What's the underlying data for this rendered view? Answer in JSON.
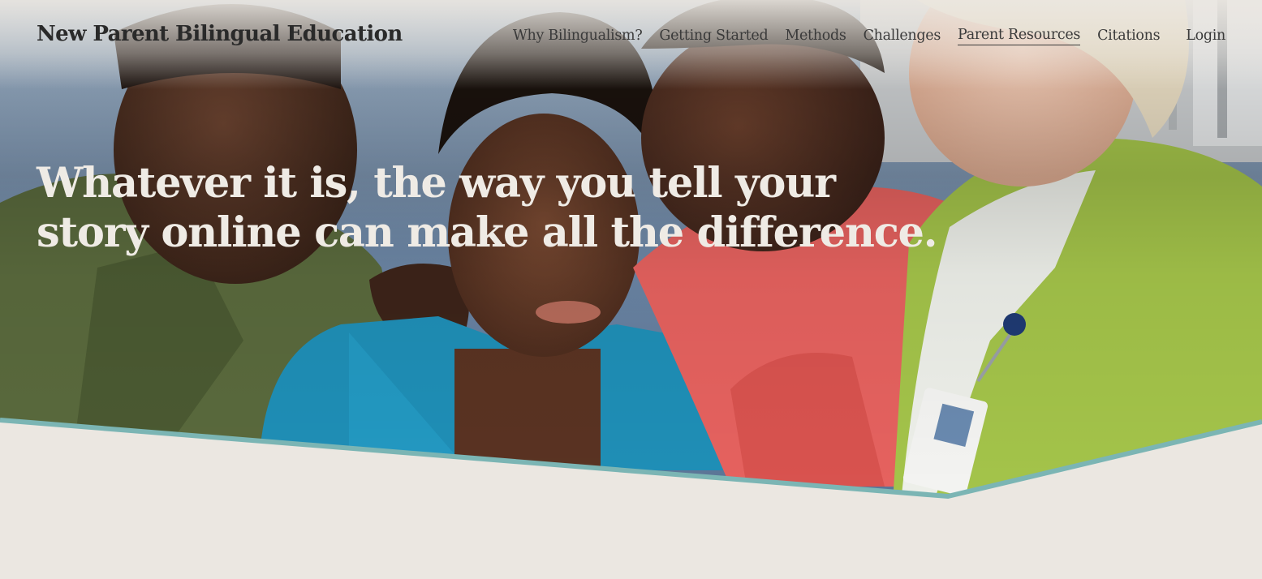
{
  "header": {
    "site_title": "New Parent Bilingual Education",
    "nav": [
      {
        "label": "Why Bilingualism?",
        "active": false
      },
      {
        "label": "Getting Started",
        "active": false
      },
      {
        "label": "Methods",
        "active": false
      },
      {
        "label": "Challenges",
        "active": false
      },
      {
        "label": "Parent Resources",
        "active": true
      },
      {
        "label": "Citations",
        "active": false
      }
    ],
    "login_label": "Login"
  },
  "hero": {
    "headline": "Whatever it is, the way you tell your story online can make all the difference.",
    "image": "family-group-photo",
    "divider_color": "#7bb5b4"
  },
  "colors": {
    "page_background": "#ebe7e1",
    "headline_text": "#efebe5",
    "nav_text": "#3a3a3a",
    "title_text": "#2a2a2a"
  }
}
